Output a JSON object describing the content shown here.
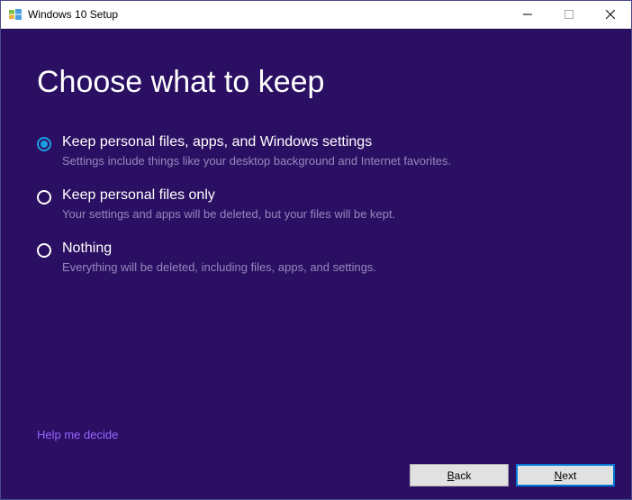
{
  "titlebar": {
    "title": "Windows 10 Setup"
  },
  "main": {
    "heading": "Choose what to keep",
    "options": [
      {
        "title": "Keep personal files, apps, and Windows settings",
        "desc": "Settings include things like your desktop background and Internet favorites.",
        "selected": true
      },
      {
        "title": "Keep personal files only",
        "desc": "Your settings and apps will be deleted, but your files will be kept.",
        "selected": false
      },
      {
        "title": "Nothing",
        "desc": "Everything will be deleted, including files, apps, and settings.",
        "selected": false
      }
    ],
    "help_link": "Help me decide"
  },
  "footer": {
    "back": "Back",
    "next": "Next"
  }
}
